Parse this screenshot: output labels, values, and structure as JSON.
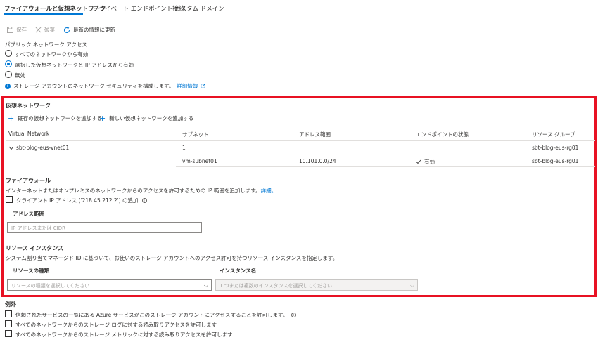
{
  "tabs": [
    {
      "label": "ファイアウォールと仮想ネットワーク",
      "active": true
    },
    {
      "label": "プライベート エンドポイント接続",
      "active": false
    },
    {
      "label": "カスタム ドメイン",
      "active": false
    }
  ],
  "toolbar": {
    "save_label": "保存",
    "discard_label": "破棄",
    "refresh_label": "最新の情報に更新"
  },
  "public_access": {
    "title": "パブリック ネットワーク アクセス",
    "options": [
      {
        "label": "すべてのネットワークから有効",
        "checked": false
      },
      {
        "label": "選択した仮想ネットワークと IP アドレスから有効",
        "checked": true
      },
      {
        "label": "無効",
        "checked": false
      }
    ],
    "info_text": "ストレージ アカウントのネットワーク セキュリティを構成します。",
    "info_link": "詳細情報"
  },
  "vnet": {
    "title": "仮想ネットワーク",
    "add_existing": "既存の仮想ネットワークを追加する",
    "add_new": "新しい仮想ネットワークを追加する",
    "columns": [
      "Virtual Network",
      "サブネット",
      "アドレス範囲",
      "エンドポイントの状態",
      "リソース グループ"
    ],
    "group_row": {
      "name": "sbt-blog-eus-vnet01",
      "subnets": "1",
      "address": "",
      "status": "",
      "rg": "sbt-blog-eus-rg01"
    },
    "subnet_row": {
      "name": "",
      "subnet": "vm-subnet01",
      "address": "10.101.0.0/24",
      "status": "有効",
      "rg": "sbt-blog-eus-rg01"
    }
  },
  "firewall": {
    "title": "ファイアウォール",
    "desc": "インターネットまたはオンプレミスのネットワークからのアクセスを許可するための IP 範囲を追加します。",
    "desc_link": "詳細。",
    "client_ip_label": "クライアント IP アドレス ('218.45.212.2') の追加",
    "address_range_label": "アドレス範囲",
    "address_placeholder": "IP アドレスまたは CIDR"
  },
  "resource_instances": {
    "title": "リソース インスタンス",
    "desc": "システム割り当てマネージド ID に基づいて、お使いのストレージ アカウントへのアクセス許可を持つリソース インスタンスを指定します。",
    "type_label": "リソースの種類",
    "instance_label": "インスタンス名",
    "type_placeholder": "リソースの種類を選択してください",
    "instance_placeholder": "1 つまたは複数のインスタンスを選択してください"
  },
  "exceptions": {
    "title": "例外",
    "items": [
      "信頼されたサービスの一覧にある Azure サービスがこのストレージ アカウントにアクセスすることを許可します。",
      "すべてのネットワークからのストレージ ログに対する読み取りアクセスを許可します",
      "すべてのネットワークからのストレージ メトリックに対する読み取りアクセスを許可します"
    ]
  },
  "colors": {
    "accent": "#0078d4",
    "highlight_border": "#e81123",
    "success": "#107c10"
  }
}
